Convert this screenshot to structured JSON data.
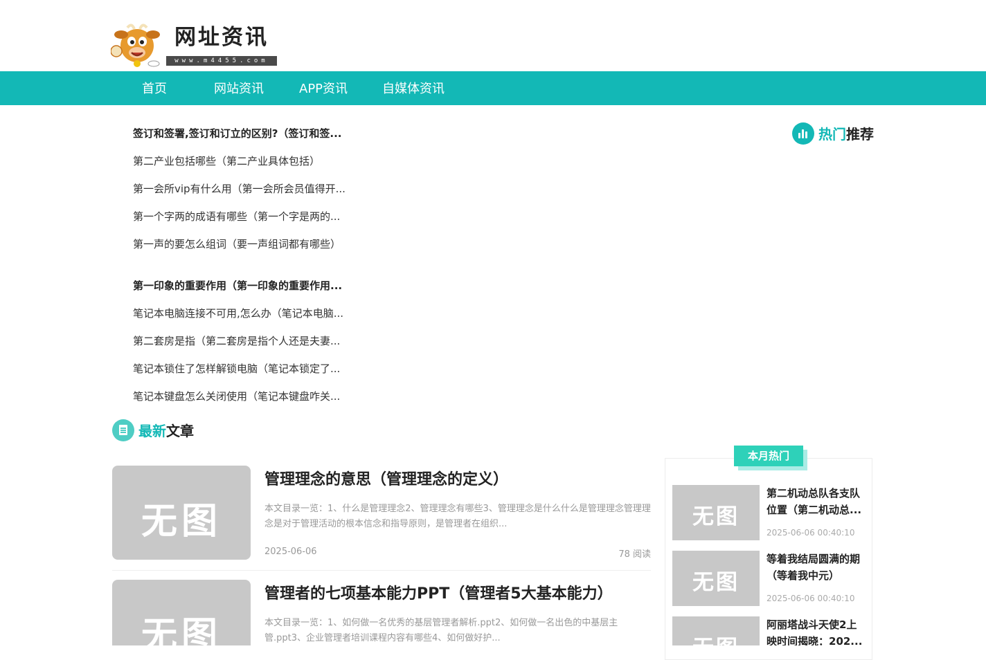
{
  "site": {
    "title": "网址资讯",
    "url": "www.m4455.com"
  },
  "nav": [
    "首页",
    "网站资讯",
    "APP资讯",
    "自媒体资讯"
  ],
  "top_list": [
    "签订和签署,签订和订立的区别?（签订和签...",
    "第二产业包括哪些（第二产业具体包括）",
    "第一会所vip有什么用（第一会所会员值得开...",
    "第一个字两的成语有哪些（第一个字是两的...",
    "第一声的要怎么组词（要一声组词都有哪些）",
    "第一印象的重要作用（第一印象的重要作用...",
    "笔记本电脑连接不可用,怎么办（笔记本电脑...",
    "第二套房是指（第二套房是指个人还是夫妻...",
    "笔记本锁住了怎样解锁电脑（笔记本锁定了...",
    "笔记本键盘怎么关闭使用（笔记本键盘咋关..."
  ],
  "hot": {
    "accent": "热门",
    "rest": "推荐",
    "icon": "bar-chart-icon"
  },
  "latest": {
    "accent": "最新",
    "rest": "文章",
    "icon": "document-icon"
  },
  "no_image": "无图",
  "articles": [
    {
      "title": "管理理念的意思（管理理念的定义）",
      "excerpt": "本文目录一览：1、什么是管理理念2、管理理念有哪些3、管理理念是什么什么是管理理念管理理念是对于管理活动的根本信念和指导原则，是管理者在组织...",
      "date": "2025-06-06",
      "views": "78 阅读"
    },
    {
      "title": "管理者的七项基本能力PPT（管理者5大基本能力）",
      "excerpt": "本文目录一览：1、如何做一名优秀的基层管理者解析.ppt2、如何做一名出色的中基层主管.ppt3、企业管理者培训课程内容有哪些4、如何做好护...",
      "date": "",
      "views": ""
    }
  ],
  "monthly": {
    "tab": "本月热门",
    "items": [
      {
        "title": "第二机动总队各支队位置（第二机动总...",
        "date": "2025-06-06 00:40:10"
      },
      {
        "title": "等着我结局圆满的期（等着我中元）",
        "date": "2025-06-06 00:40:10"
      },
      {
        "title": "阿丽塔战斗天使2上映时间揭晓：202...",
        "date": ""
      }
    ]
  },
  "colors": {
    "primary": "#13b8b6",
    "tab": "#2ed1b9",
    "placeholder": "#c8c8c8"
  }
}
